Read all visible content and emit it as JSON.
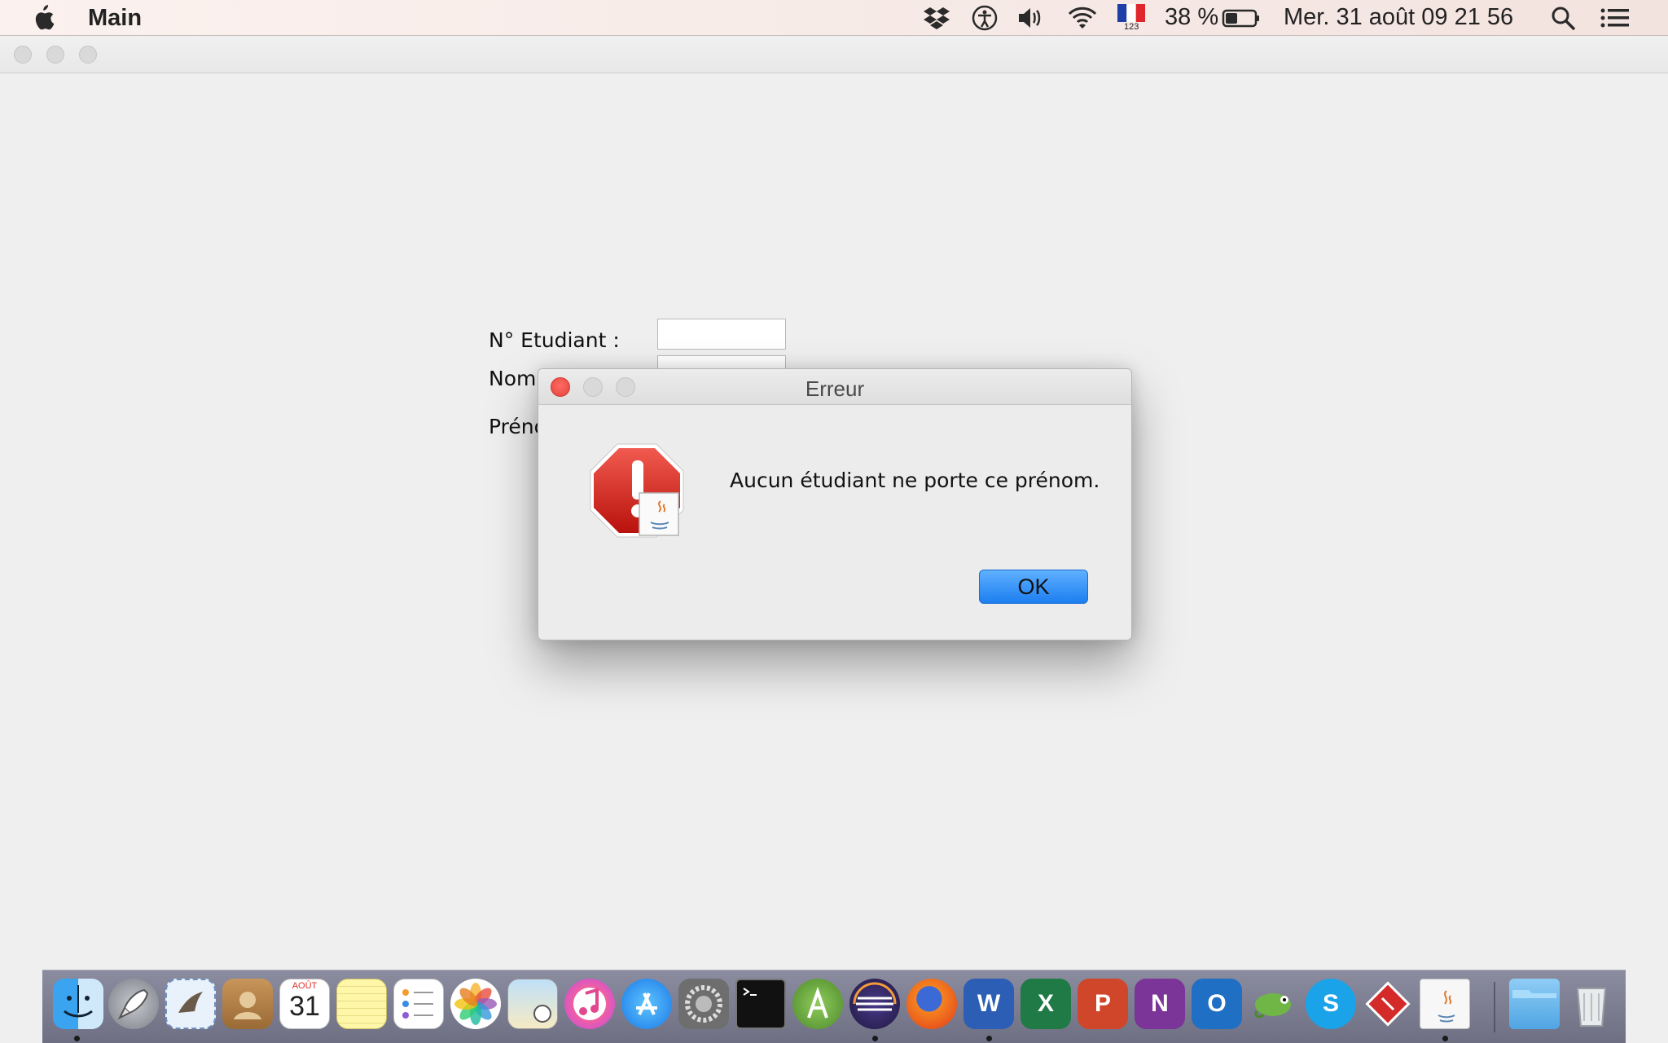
{
  "menubar": {
    "app_name": "Main",
    "battery_text": "38 %",
    "input_source_sub": "123",
    "datetime": "Mer. 31 août  09 21 56",
    "icons": [
      "apple-icon",
      "dropbox-icon",
      "accessibility-icon",
      "volume-icon",
      "wifi-icon",
      "flag-fr-icon",
      "battery-icon",
      "spotlight-icon",
      "notification-center-icon"
    ]
  },
  "form": {
    "student_number_label": "N° Etudiant :",
    "name_label": "Nom",
    "firstname_label": "Préno"
  },
  "dialog": {
    "title": "Erreur",
    "message": "Aucun étudiant ne porte ce prénom.",
    "ok_label": "OK",
    "icon": "error-stop-icon"
  },
  "dock": {
    "calendar_month": "AOÛT",
    "calendar_day": "31",
    "items": [
      "finder",
      "launchpad",
      "mail",
      "contacts",
      "calendar",
      "notes",
      "reminders",
      "photos",
      "preview",
      "itunes",
      "app-store",
      "system-preferences",
      "terminal",
      "android-studio",
      "eclipse",
      "firefox",
      "word",
      "excel",
      "powerpoint",
      "onenote",
      "outlook",
      "chameleon",
      "skype",
      "git",
      "java",
      "downloads-folder",
      "trash"
    ]
  },
  "colors": {
    "accent": "#1c7ef0",
    "error_red": "#d9231c"
  }
}
